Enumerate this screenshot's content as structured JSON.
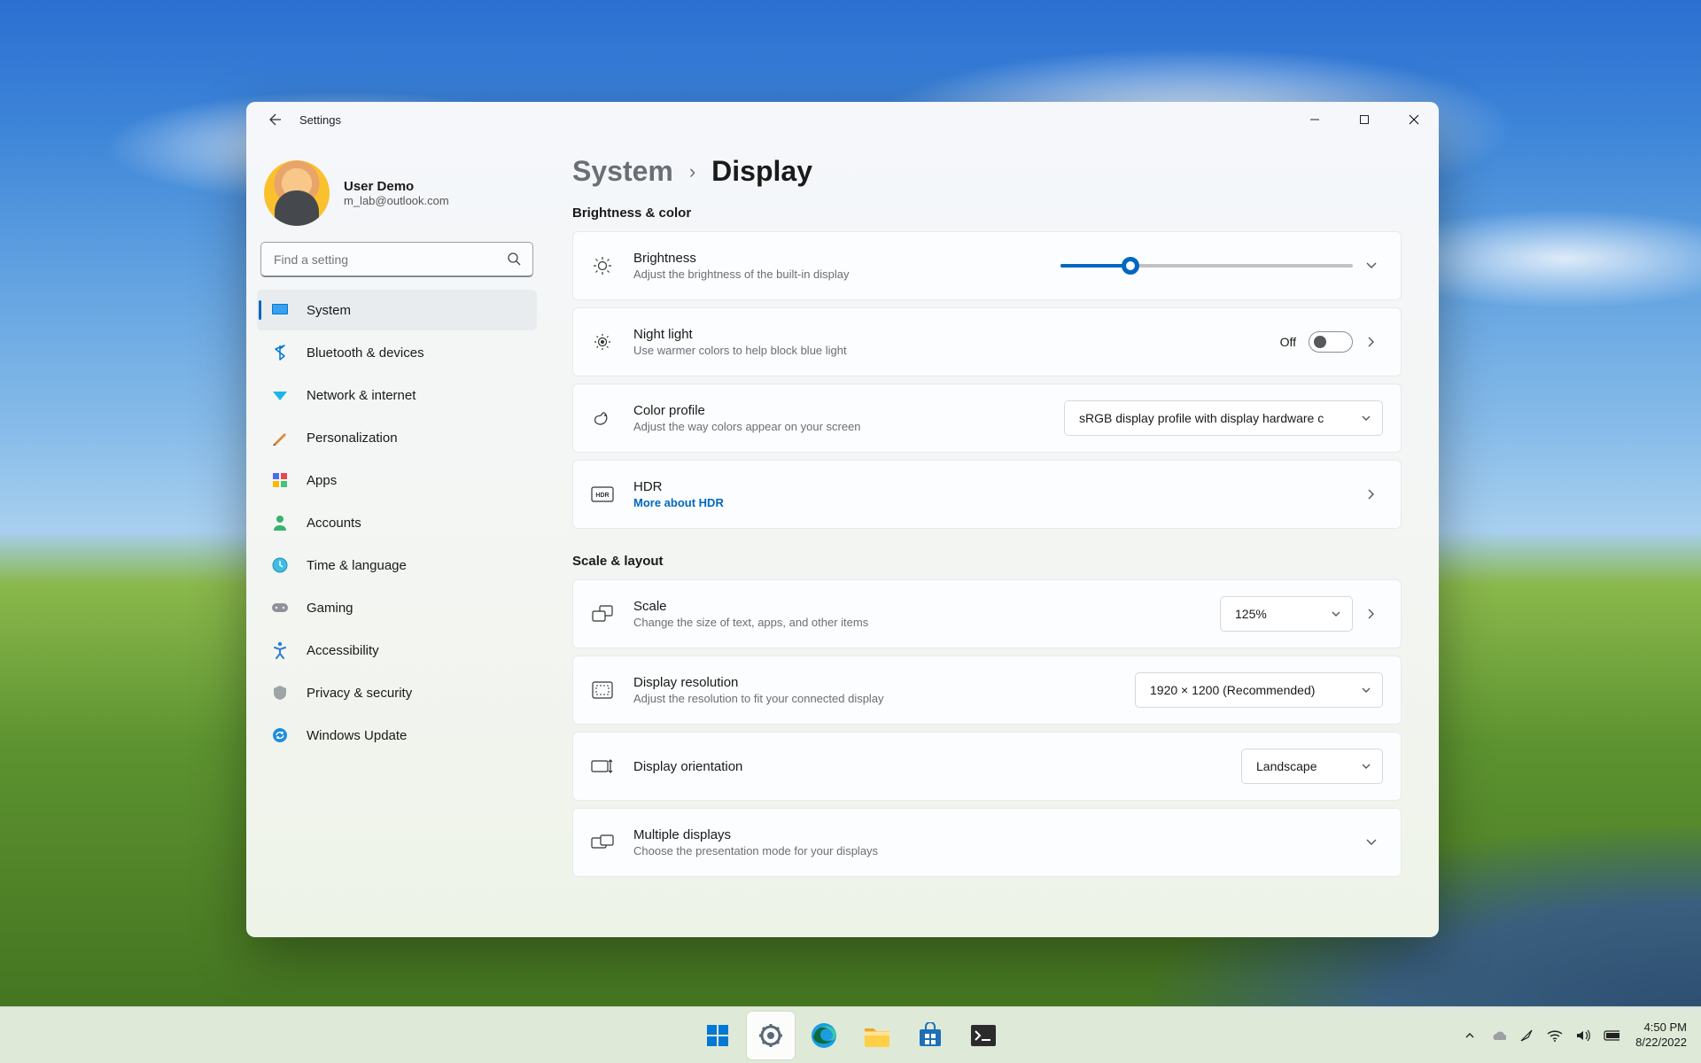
{
  "window": {
    "title": "Settings"
  },
  "profile": {
    "name": "User Demo",
    "email": "m_lab@outlook.com"
  },
  "search": {
    "placeholder": "Find a setting"
  },
  "sidebar": {
    "items": [
      {
        "label": "System"
      },
      {
        "label": "Bluetooth & devices"
      },
      {
        "label": "Network & internet"
      },
      {
        "label": "Personalization"
      },
      {
        "label": "Apps"
      },
      {
        "label": "Accounts"
      },
      {
        "label": "Time & language"
      },
      {
        "label": "Gaming"
      },
      {
        "label": "Accessibility"
      },
      {
        "label": "Privacy & security"
      },
      {
        "label": "Windows Update"
      }
    ]
  },
  "breadcrumb": {
    "parent": "System",
    "current": "Display"
  },
  "sections": {
    "brightness": {
      "title": "Brightness & color"
    },
    "scale": {
      "title": "Scale & layout"
    }
  },
  "settings": {
    "brightness": {
      "title": "Brightness",
      "sub": "Adjust the brightness of the built-in display",
      "value_pct": 24
    },
    "nightlight": {
      "title": "Night light",
      "sub": "Use warmer colors to help block blue light",
      "state_label": "Off",
      "enabled": false
    },
    "colorprofile": {
      "title": "Color profile",
      "sub": "Adjust the way colors appear on your screen",
      "selected": "sRGB display profile with display hardware c"
    },
    "hdr": {
      "title": "HDR",
      "link": "More about HDR"
    },
    "scale": {
      "title": "Scale",
      "sub": "Change the size of text, apps, and other items",
      "selected": "125%"
    },
    "resolution": {
      "title": "Display resolution",
      "sub": "Adjust the resolution to fit your connected display",
      "selected": "1920 × 1200 (Recommended)"
    },
    "orientation": {
      "title": "Display orientation",
      "selected": "Landscape"
    },
    "multiple": {
      "title": "Multiple displays",
      "sub": "Choose the presentation mode for your displays"
    }
  },
  "taskbar": {
    "time": "4:50 PM",
    "date": "8/22/2022"
  }
}
